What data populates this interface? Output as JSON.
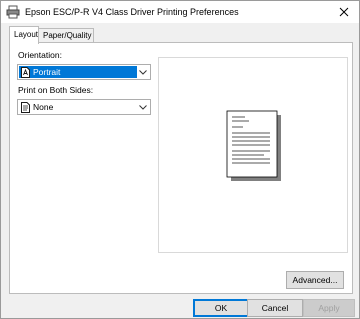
{
  "window": {
    "title": "Epson ESC/P-R V4 Class Driver Printing Preferences"
  },
  "tabs": [
    {
      "label": "Layout",
      "active": true
    },
    {
      "label": "Paper/Quality",
      "active": false
    }
  ],
  "layout": {
    "orientation_label": "Orientation:",
    "orientation_value": "Portrait",
    "duplex_label": "Print on Both Sides:",
    "duplex_value": "None",
    "advanced_label": "Advanced..."
  },
  "footer": {
    "ok_label": "OK",
    "cancel_label": "Cancel",
    "apply_label": "Apply"
  },
  "colors": {
    "accent": "#0078d7",
    "face": "#f0f0f0"
  },
  "icons": {
    "title": "printer-icon",
    "close": "close-icon",
    "orientation": "portrait-page-icon",
    "dropdown": "chevron-down-icon"
  }
}
